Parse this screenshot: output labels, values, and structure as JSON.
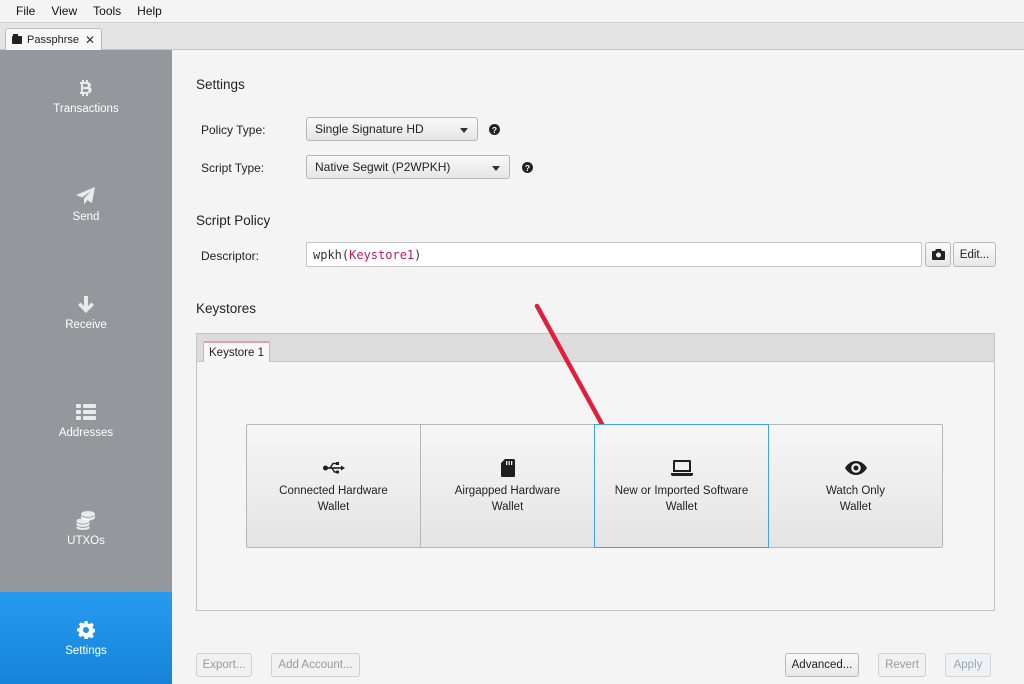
{
  "menu": [
    "File",
    "View",
    "Tools",
    "Help"
  ],
  "wallet_tab": {
    "label": "Passphrse",
    "close": "✕"
  },
  "sidebar": {
    "items": [
      {
        "label": "Transactions",
        "icon": "bitcoin-icon"
      },
      {
        "label": "Send",
        "icon": "paper-plane-icon"
      },
      {
        "label": "Receive",
        "icon": "arrow-down-icon"
      },
      {
        "label": "Addresses",
        "icon": "list-icon"
      },
      {
        "label": "UTXOs",
        "icon": "coins-icon"
      },
      {
        "label": "Settings",
        "icon": "gear-icon",
        "active": true
      }
    ]
  },
  "settings": {
    "title": "Settings",
    "policy_label": "Policy Type:",
    "policy_value": "Single Signature HD",
    "script_label": "Script Type:",
    "script_value": "Native Segwit (P2WPKH)",
    "help_glyph": "?"
  },
  "script_policy": {
    "title": "Script Policy",
    "descriptor_label": "Descriptor:",
    "descriptor_fn_open": "wpkh(",
    "descriptor_keystore": "Keystore1",
    "descriptor_fn_close": ")",
    "edit_label": "Edit..."
  },
  "keystores": {
    "title": "Keystores",
    "tab_label": "Keystore 1",
    "options": [
      {
        "line1": "Connected Hardware",
        "line2": "Wallet",
        "icon": "usb-icon"
      },
      {
        "line1": "Airgapped Hardware",
        "line2": "Wallet",
        "icon": "sd-card-icon"
      },
      {
        "line1": "New or Imported Software",
        "line2": "Wallet",
        "icon": "laptop-icon",
        "selected": true
      },
      {
        "line1": "Watch Only",
        "line2": "Wallet",
        "icon": "eye-icon"
      }
    ]
  },
  "footer": {
    "export": "Export...",
    "add_account": "Add Account...",
    "advanced": "Advanced...",
    "revert": "Revert",
    "apply": "Apply"
  },
  "colors": {
    "sidebar": "#94979b",
    "active_nav": "#1f8ee6",
    "selected_border": "#3ea2e8",
    "keystore_text": "#c2185b",
    "annotation_arrow": "#e0203a"
  }
}
